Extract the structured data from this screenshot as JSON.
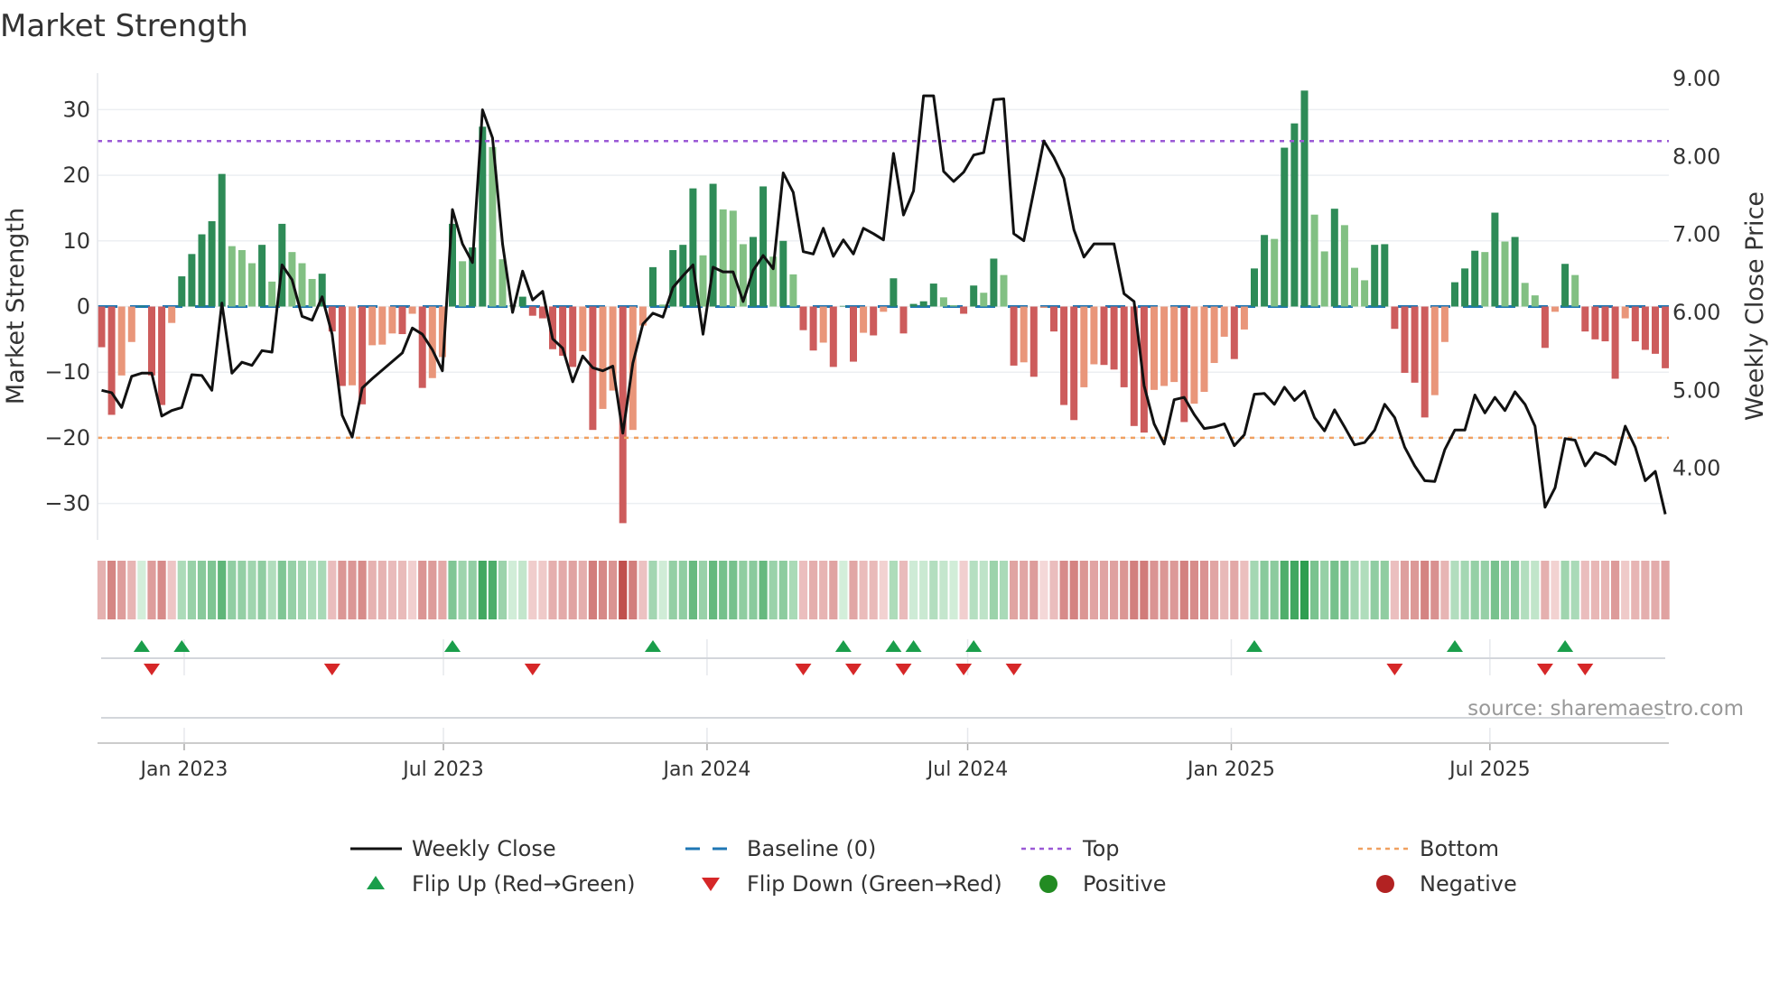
{
  "title": "Market Strength",
  "source": "source: sharemaestro.com",
  "colors": {
    "bar_pos_strong": "#2e8b57",
    "bar_pos_weak": "#82c083",
    "bar_neg_strong": "#cd5c5c",
    "bar_neg_weak": "#e9967a",
    "close": "#111111",
    "baseline": "#1f77b4",
    "top": "#9b59d6",
    "bottom": "#f0a060",
    "flip_up": "#1a9e4b",
    "flip_down": "#d62728",
    "positive": "#228b22",
    "negative": "#b22222"
  },
  "legend": [
    {
      "key": "close",
      "label": "Weekly Close"
    },
    {
      "key": "baseline",
      "label": "Baseline (0)"
    },
    {
      "key": "top",
      "label": "Top"
    },
    {
      "key": "bottom",
      "label": "Bottom"
    },
    {
      "key": "flip_up",
      "label": "Flip Up (Red→Green)"
    },
    {
      "key": "flip_down",
      "label": "Flip Down (Green→Red)"
    },
    {
      "key": "positive",
      "label": "Positive"
    },
    {
      "key": "negative",
      "label": "Negative"
    }
  ],
  "chart_data": {
    "type": "bar",
    "title": "Market Strength",
    "ylabel": "Market Strength",
    "ylabel_right": "Weekly Close Price",
    "ylim": [
      -35.5,
      35.5
    ],
    "ylim_right": [
      3.09,
      9.07
    ],
    "yticks_left": [
      {
        "value": 30,
        "label": "30"
      },
      {
        "value": 20,
        "label": "20"
      },
      {
        "value": 10,
        "label": "10"
      },
      {
        "value": 0,
        "label": "0"
      },
      {
        "value": -10,
        "label": "−10"
      },
      {
        "value": -20,
        "label": "−20"
      },
      {
        "value": -30,
        "label": "−30"
      }
    ],
    "yticks_right": [
      {
        "value": 9,
        "label": "9.00"
      },
      {
        "value": 8,
        "label": "8.00"
      },
      {
        "value": 7,
        "label": "7.00"
      },
      {
        "value": 6,
        "label": "6.00"
      },
      {
        "value": 5,
        "label": "5.00"
      },
      {
        "value": 4,
        "label": "4.00"
      }
    ],
    "xticks": [
      {
        "week": 8.24,
        "label": "Jan 2023"
      },
      {
        "week": 34.1,
        "label": "Jul 2023"
      },
      {
        "week": 60.4,
        "label": "Jan 2024"
      },
      {
        "week": 86.4,
        "label": "Jul 2024"
      },
      {
        "week": 112.7,
        "label": "Jan 2025"
      },
      {
        "week": 138.5,
        "label": "Jul 2025"
      }
    ],
    "top_level": 25.2,
    "bottom_level": -20,
    "baseline": 0,
    "grid": "horizontal",
    "legend_position": "bottom",
    "strength": [
      -6.2,
      -16.5,
      -10.5,
      -5.4,
      0.1,
      -10.5,
      -15,
      -2.5,
      4.6,
      8,
      11,
      13,
      20.2,
      9.2,
      8.6,
      6.6,
      9.4,
      3.8,
      12.6,
      8.3,
      6.6,
      4.2,
      5,
      -3.8,
      -12.1,
      -12.0,
      -14.9,
      -5.9,
      -5.8,
      -4.1,
      -4.2,
      -1.1,
      -12.4,
      -10.9,
      -7.7,
      12.6,
      6.9,
      9,
      27.4,
      24.3,
      7.2,
      0.2,
      1.5,
      -1.4,
      -1.8,
      -6.5,
      -7.5,
      -9.2,
      -6.8,
      -18.8,
      -15.6,
      -12.8,
      -33,
      -18.8,
      -2.9,
      6,
      0.3,
      8.6,
      9.4,
      18,
      7.8,
      18.7,
      14.8,
      14.6,
      9.5,
      10.6,
      18.3,
      7.6,
      10,
      4.9,
      -3.6,
      -6.7,
      -5.5,
      -9.2,
      0.1,
      -8.4,
      -4,
      -4.4,
      -0.8,
      4.3,
      -4.1,
      0.4,
      0.8,
      3.5,
      1.4,
      0.2,
      -1.1,
      3.2,
      2.1,
      7.3,
      4.8,
      -9,
      -8.5,
      -10.7,
      -0.2,
      -3.8,
      -15,
      -17.3,
      -12.3,
      -8.8,
      -8.9,
      -9.6,
      -12.3,
      -18.2,
      -19.2,
      -12.7,
      -12.1,
      -11.5,
      -17.6,
      -14.8,
      -13,
      -8.6,
      -4.6,
      -8,
      -3.5,
      5.8,
      10.9,
      10.3,
      24.2,
      27.9,
      32.9,
      14,
      8.4,
      14.9,
      12.4,
      5.9,
      4,
      9.4,
      9.5,
      -3.4,
      -10.1,
      -11.6,
      -16.9,
      -13.5,
      -5.4,
      3.7,
      5.8,
      8.5,
      8.3,
      14.3,
      9.9,
      10.6,
      3.6,
      1.7,
      -6.3,
      -0.8,
      6.5,
      4.8,
      -3.8,
      -5,
      -5.3,
      -11,
      -1.8,
      -5.3,
      -6.6,
      -7.2,
      -9.4
    ],
    "weekly_close": [
      5.0,
      4.97,
      4.78,
      5.18,
      5.22,
      5.22,
      4.67,
      4.74,
      4.78,
      5.2,
      5.19,
      5.0,
      6.12,
      5.22,
      5.36,
      5.32,
      5.51,
      5.49,
      6.61,
      6.42,
      5.95,
      5.9,
      6.2,
      5.72,
      4.68,
      4.4,
      5.03,
      5.15,
      5.26,
      5.37,
      5.48,
      5.8,
      5.72,
      5.52,
      5.25,
      7.32,
      6.88,
      6.64,
      8.6,
      8.24,
      6.88,
      6.0,
      6.53,
      6.16,
      6.27,
      5.66,
      5.54,
      5.11,
      5.44,
      5.29,
      5.25,
      5.31,
      4.45,
      5.35,
      5.85,
      5.99,
      5.94,
      6.32,
      6.47,
      6.61,
      5.72,
      6.58,
      6.52,
      6.52,
      6.14,
      6.54,
      6.73,
      6.56,
      7.79,
      7.54,
      6.78,
      6.75,
      7.08,
      6.72,
      6.93,
      6.75,
      7.08,
      7.01,
      6.93,
      8.04,
      7.25,
      7.56,
      8.78,
      8.78,
      7.81,
      7.68,
      7.8,
      8.02,
      8.05,
      8.73,
      8.74,
      7.01,
      6.92,
      7.56,
      8.2,
      7.99,
      7.72,
      7.06,
      6.71,
      6.88,
      6.88,
      6.88,
      6.24,
      6.14,
      5.06,
      4.57,
      4.31,
      4.88,
      4.91,
      4.69,
      4.51,
      4.53,
      4.57,
      4.29,
      4.43,
      4.95,
      4.96,
      4.82,
      5.04,
      4.87,
      4.99,
      4.65,
      4.48,
      4.75,
      4.53,
      4.3,
      4.33,
      4.49,
      4.82,
      4.65,
      4.27,
      4.03,
      3.84,
      3.83,
      4.24,
      4.49,
      4.49,
      4.94,
      4.71,
      4.91,
      4.74,
      4.98,
      4.82,
      4.54,
      3.5,
      3.75,
      4.38,
      4.36,
      4.03,
      4.2,
      4.15,
      4.05,
      4.54,
      4.27,
      3.84,
      3.96,
      3.41
    ]
  }
}
